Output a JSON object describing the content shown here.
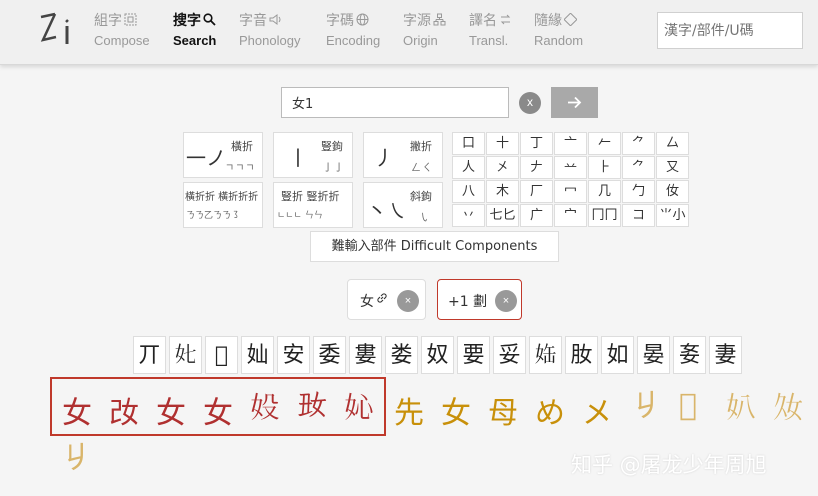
{
  "nav": {
    "items": [
      {
        "zh": "組字",
        "en": "Compose",
        "icon": "grid-icon"
      },
      {
        "zh": "搜字",
        "en": "Search",
        "icon": "search-icon"
      },
      {
        "zh": "字音",
        "en": "Phonology",
        "icon": "speaker-icon"
      },
      {
        "zh": "字碼",
        "en": "Encoding",
        "icon": "globe-icon"
      },
      {
        "zh": "字源",
        "en": "Origin",
        "icon": "tree-icon"
      },
      {
        "zh": "譯名",
        "en": "Transl.",
        "icon": "swap-icon"
      },
      {
        "zh": "隨緣",
        "en": "Random",
        "icon": "dice-icon"
      }
    ],
    "active": "Search",
    "search_placeholder": "漢字/部件/U碼"
  },
  "query": {
    "value": "女1",
    "clear_label": "x",
    "go_label": "→"
  },
  "strokes": {
    "s1": {
      "big": "一ノ",
      "label": "橫折",
      "sub": "ㄱㄱㄱ"
    },
    "s2": {
      "big": "丨",
      "label": "豎鉤",
      "sub": "亅亅"
    },
    "s3": {
      "big": "丿",
      "label": "撇折",
      "sub": "ㄥㄑ"
    },
    "s4": {
      "label": "橫折折 橫折折折",
      "sub": "ㄋㄋ乙ㄋㄋ㇌"
    },
    "s5": {
      "label": "豎折 豎折折",
      "sub": "ㄴㄴㄴ ㄣㄣ"
    },
    "s6": {
      "big": "丶㇏",
      "label": "斜鉤",
      "sub": "㇂"
    }
  },
  "components": [
    "口",
    "十",
    "丁",
    "亠",
    "𠂉",
    "⺈",
    "厶",
    "人",
    "㐅",
    "𠂇",
    "䒑",
    "⺊",
    "⺈",
    "又",
    "八",
    "木",
    "厂",
    "冖",
    "几",
    "勹",
    "㚢",
    "丷",
    "七匕",
    "广",
    "宀",
    "冂冂",
    "コ",
    "⺌小"
  ],
  "difficult_label": "難輸入部件 Difficult Components",
  "filters": [
    {
      "label": "女",
      "link_icon": "🔗",
      "remove": "×"
    },
    {
      "label": "+1 劃",
      "remove": "×"
    }
  ],
  "results": [
    "丌",
    "𡚨",
    "𡛊",
    "奾",
    "安",
    "委",
    "婁",
    "娄",
    "奴",
    "要",
    "妥",
    "𡜊",
    "肗",
    "如",
    "晏",
    "㚣",
    "妻"
  ],
  "variants_red": [
    "女",
    "妀",
    "女",
    "女",
    "𡚾",
    "𡚽",
    "𡚿"
  ],
  "variants_gold": [
    "先",
    "女",
    "母",
    "め",
    "メ"
  ],
  "variants_light": [
    "𠂈",
    "𡚬",
    "𡚭",
    "𡚮",
    "𠂈"
  ],
  "watermark": "知乎 @屠龙少年周旭"
}
